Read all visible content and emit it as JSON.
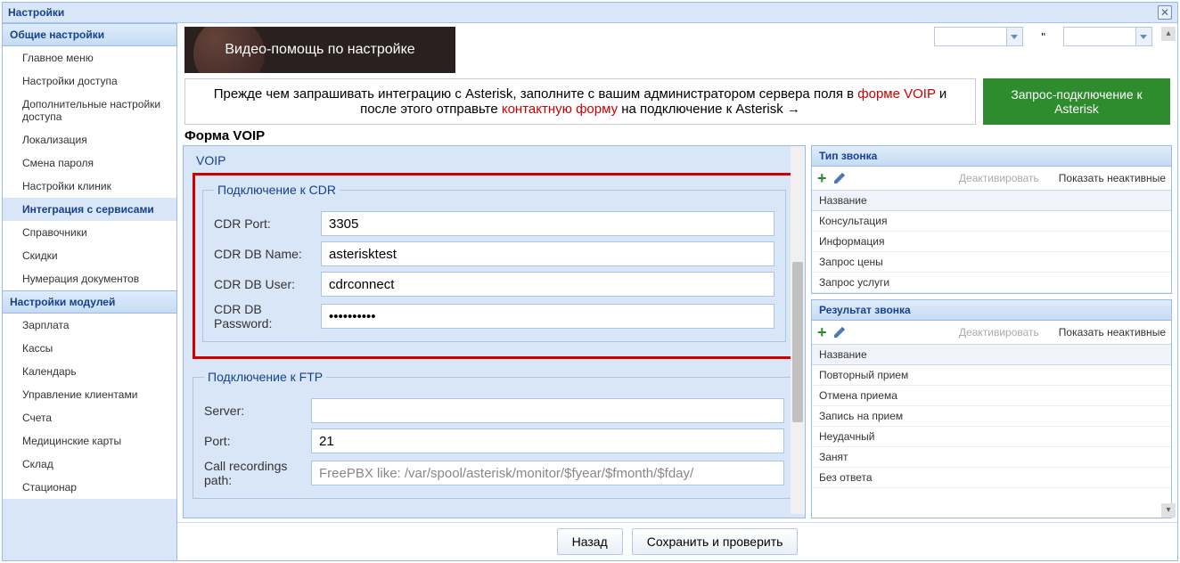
{
  "window": {
    "title": "Настройки"
  },
  "sidebar": {
    "group1_header": "Общие настройки",
    "group1": [
      "Главное меню",
      "Настройки доступа",
      "Дополнительные настройки доступа",
      "Локализация",
      "Смена пароля",
      "Настройки клиник",
      "Интеграция с сервисами",
      "Справочники",
      "Скидки",
      "Нумерация документов"
    ],
    "active1": 6,
    "group2_header": "Настройки модулей",
    "group2": [
      "Зарплата",
      "Кассы",
      "Календарь",
      "Управление клиентами",
      "Счета",
      "Медицинские карты",
      "Склад",
      "Стационар"
    ]
  },
  "video_help": "Видео-помощь по настройке",
  "info": {
    "pre": "Прежде чем запрашивать интеграцию с Asterisk, заполните с вашим администратором сервера поля в ",
    "red1": "форме VOIP",
    "mid": " и после этого отправьте ",
    "red2": "контактную форму",
    "post": " на подключение к Asterisk →"
  },
  "green_button": "Запрос-подключение к Asterisk",
  "form_title": "Форма VOIP",
  "voip_legend": "VOIP",
  "cdr": {
    "legend": "Подключение к CDR",
    "port_label": "CDR Port:",
    "port_value": "3305",
    "dbname_label": "CDR DB Name:",
    "dbname_value": "asterisktest",
    "dbuser_label": "CDR DB User:",
    "dbuser_value": "cdrconnect",
    "dbpass_label": "CDR DB Password:",
    "dbpass_value": "••••••••••"
  },
  "ftp": {
    "legend": "Подключение к FTP",
    "server_label": "Server:",
    "server_value": "",
    "port_label": "Port:",
    "port_value": "21",
    "path_label": "Call recordings path:",
    "path_placeholder": "FreePBX like: /var/spool/asterisk/monitor/$fyear/$fmonth/$fday/"
  },
  "panel1": {
    "title": "Тип звонка",
    "deactivate": "Деактивировать",
    "show_inactive": "Показать неактивные",
    "col": "Название",
    "rows": [
      "Консультация",
      "Информация",
      "Запрос цены",
      "Запрос услуги"
    ]
  },
  "panel2": {
    "title": "Результат звонка",
    "deactivate": "Деактивировать",
    "show_inactive": "Показать неактивные",
    "col": "Название",
    "rows": [
      "Повторный прием",
      "Отмена приема",
      "Запись на прием",
      "Неудачный",
      "Занят",
      "Без ответа"
    ]
  },
  "footer": {
    "back": "Назад",
    "save": "Сохранить и проверить"
  }
}
